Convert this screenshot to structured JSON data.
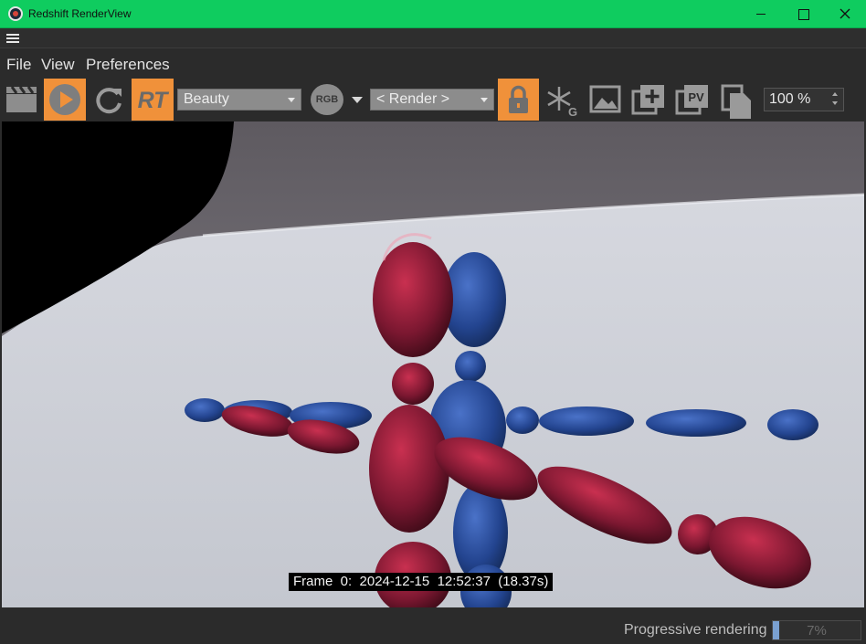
{
  "window": {
    "title": "Redshift RenderView"
  },
  "menu": {
    "file": "File",
    "view": "View",
    "preferences": "Preferences"
  },
  "toolbar": {
    "rt_label": "RT",
    "aov_selected": "Beauty",
    "rgb_label": "RGB",
    "camera_selected": "< Render >",
    "pv_label": "PV",
    "zoom": "100 %"
  },
  "viewport": {
    "frame_info": "Frame  0:  2024-12-15  12:52:37  (18.37s)"
  },
  "status": {
    "text": "Progressive rendering",
    "progress_label": "7%",
    "progress": 0.07
  },
  "colors": {
    "titlebar": "#0fcc5f",
    "accent": "#f0913a",
    "background": "#2b2b2b"
  }
}
